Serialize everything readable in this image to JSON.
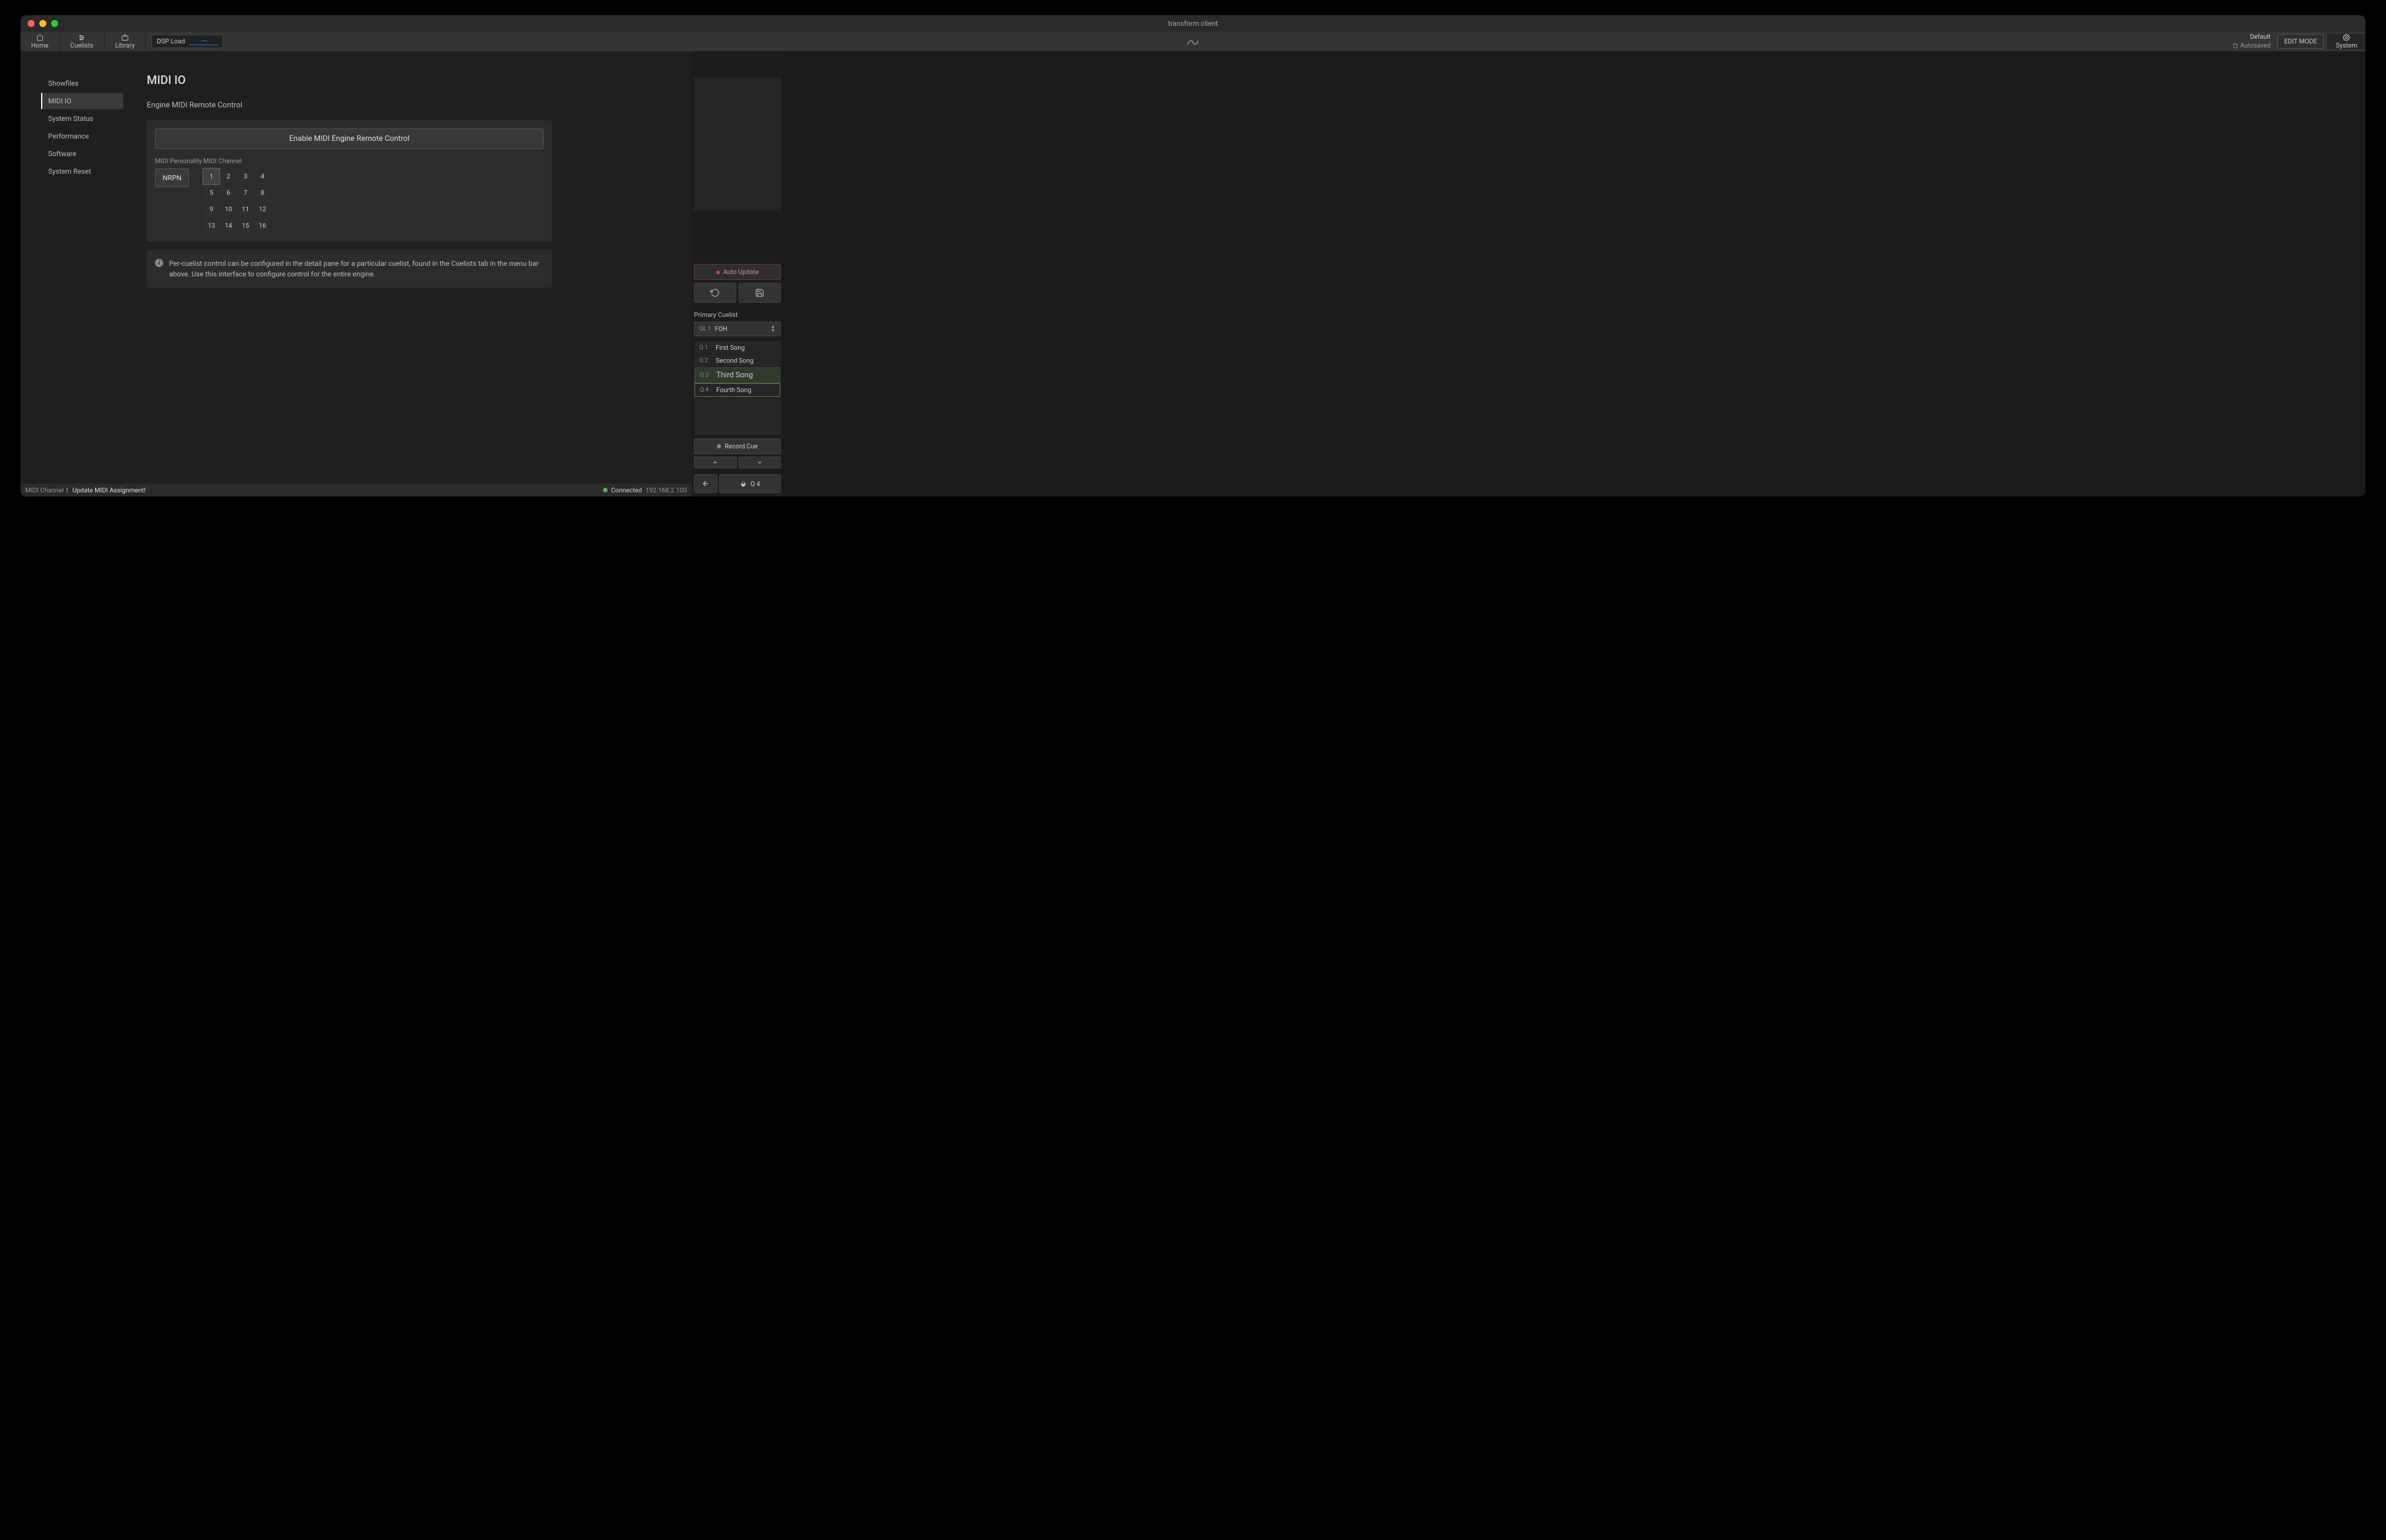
{
  "window": {
    "title": "transform.client"
  },
  "menubar": {
    "home": "Home",
    "cuelists": "Cuelists",
    "library": "Library",
    "dsp_label": "DSP Load",
    "default_label": "Default",
    "autosaved": "Autosaved",
    "edit_mode": "EDIT MODE",
    "system": "System"
  },
  "sidebar": {
    "items": [
      "Showfiles",
      "MIDI IO",
      "System Status",
      "Performance",
      "Software",
      "System Reset"
    ],
    "active_index": 1
  },
  "page": {
    "title": "MIDI IO",
    "subtitle": "Engine MIDI Remote Control",
    "enable_btn": "Enable MIDI Engine Remote Control",
    "personality_label": "MIDI Personality",
    "channel_label": "MIDI Channel",
    "personality_value": "NRPN",
    "channels": [
      "1",
      "2",
      "3",
      "4",
      "5",
      "6",
      "7",
      "8",
      "9",
      "10",
      "11",
      "12",
      "13",
      "14",
      "15",
      "16"
    ],
    "active_channel": "1",
    "info_text": "Per-cuelist control can be configured in the detail pane for a particular cuelist, found in the Cuelists tab in the menu bar above. Use this interface to configure control for the entire engine."
  },
  "statusbar": {
    "midi_ch": "MIDI Channel 1",
    "update": "Update MIDI Assignment!",
    "connected": "Connected",
    "ip": "192.168.2.100"
  },
  "right": {
    "auto_update": "Auto Update",
    "primary_cuelist_label": "Primary Cuelist",
    "ql_prefix": "QL",
    "ql_num": "1",
    "ql_name": "FOH",
    "cues": [
      {
        "id": "Q 1",
        "name": "First Song"
      },
      {
        "id": "Q 2",
        "name": "Second Song"
      },
      {
        "id": "Q 3",
        "name": "Third Song"
      },
      {
        "id": "Q 4",
        "name": "Fourth Song"
      }
    ],
    "record_cue": "Record Cue",
    "go_cue": "Q 4"
  }
}
